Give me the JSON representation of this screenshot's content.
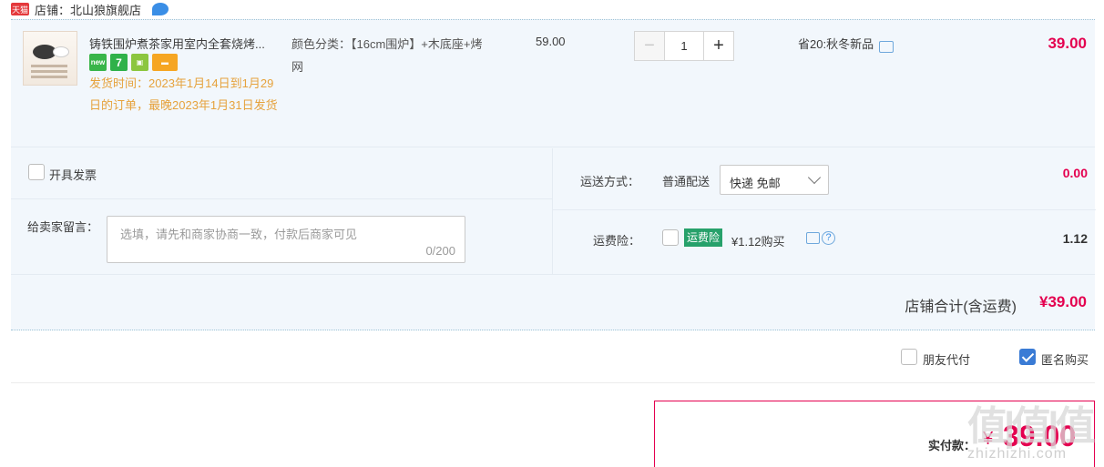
{
  "shop": {
    "badge": "天猫",
    "name": "店铺：北山狼旗舰店"
  },
  "item": {
    "title": "铸铁围炉煮茶家用室内全套烧烤...",
    "service_icons": [
      "new-icon",
      "seven-day-icon",
      "bag-icon",
      "card-icon"
    ],
    "ship_time": "发货时间：2023年1月14日到1月29日的订单，最晚2023年1月31日发货",
    "spec": "颜色分类：【16cm围炉】+木底座+烤网",
    "unit_price": "59.00",
    "quantity": "1",
    "dec_symbol": "−",
    "inc_symbol": "+",
    "promo": "省20:秋冬新品",
    "subtotal": "39.00"
  },
  "invoice": {
    "label": "开具发票"
  },
  "message": {
    "label": "给卖家留言：",
    "placeholder": "选填，请先和商家协商一致，付款后商家可见",
    "count": "0/200"
  },
  "shipping": {
    "label": "运送方式：",
    "method": "普通配送",
    "option": "快递 免邮",
    "fee": "0.00"
  },
  "insurance": {
    "label": "运费险：",
    "badge": "运费险",
    "price": "¥1.12购买",
    "help": "?",
    "fee": "1.12"
  },
  "shop_total": {
    "label": "店铺合计(含运费)",
    "value": "¥39.00"
  },
  "pay_options": {
    "friend_pay": {
      "label": "朋友代付",
      "checked": false
    },
    "anonymous": {
      "label": "匿名购买",
      "checked": true
    }
  },
  "payment": {
    "label": "实付款：",
    "currency": "¥",
    "value": "39.00"
  },
  "watermark": {
    "big": "值|值|值",
    "small": "zhizhizhi.com"
  },
  "colors": {
    "accent_red": "#e4004f",
    "panel_bg": "#f2f7fc",
    "ship_time": "#e6a23c",
    "insurance_green": "#27a16b",
    "checkbox_blue": "#3a7bd5"
  }
}
